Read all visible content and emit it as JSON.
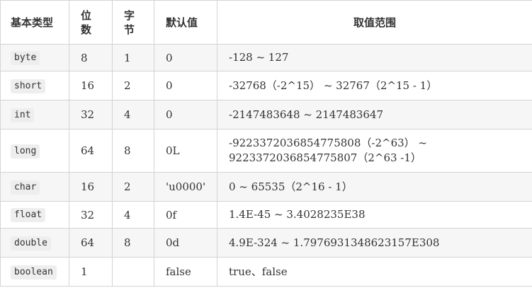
{
  "table": {
    "headers": [
      "基本类型",
      "位数",
      "字节",
      "默认值",
      "取值范围"
    ],
    "rows": [
      {
        "type": "byte",
        "bits": "8",
        "bytes": "1",
        "default": "0",
        "range": "-128 ~ 127"
      },
      {
        "type": "short",
        "bits": "16",
        "bytes": "2",
        "default": "0",
        "range": "-32768（-2^15） ~ 32767（2^15 - 1）"
      },
      {
        "type": "int",
        "bits": "32",
        "bytes": "4",
        "default": "0",
        "range": "-2147483648 ~ 2147483647"
      },
      {
        "type": "long",
        "bits": "64",
        "bytes": "8",
        "default": "0L",
        "range": "-9223372036854775808（-2^63） ~ 9223372036854775807（2^63 -1）"
      },
      {
        "type": "char",
        "bits": "16",
        "bytes": "2",
        "default": "'u0000'",
        "range": "0 ~ 65535（2^16 - 1）"
      },
      {
        "type": "float",
        "bits": "32",
        "bytes": "4",
        "default": "0f",
        "range": "1.4E-45 ~ 3.4028235E38"
      },
      {
        "type": "double",
        "bits": "64",
        "bytes": "8",
        "default": "0d",
        "range": "4.9E-324 ~ 1.7976931348623157E308"
      },
      {
        "type": "boolean",
        "bits": "1",
        "bytes": "",
        "default": "false",
        "range": "true、false"
      }
    ]
  }
}
